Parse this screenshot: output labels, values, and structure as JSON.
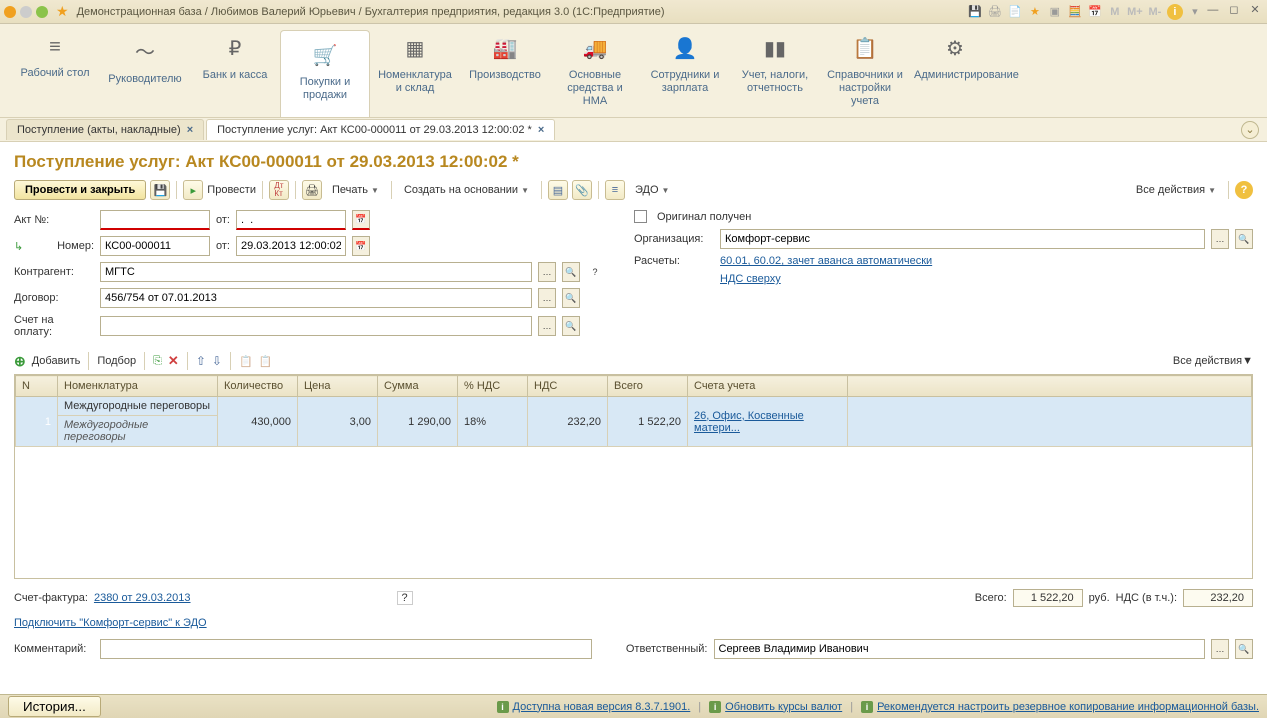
{
  "titlebar": {
    "text": "Демонстрационная база / Любимов Валерий Юрьевич / Бухгалтерия предприятия, редакция 3.0  (1С:Предприятие)"
  },
  "mainnav": [
    {
      "icon": "≡",
      "label": "Рабочий стол"
    },
    {
      "icon": "〜",
      "label": "Руководителю"
    },
    {
      "icon": "₽",
      "label": "Банк и касса"
    },
    {
      "icon": "🛒",
      "label": "Покупки и продажи"
    },
    {
      "icon": "▦",
      "label": "Номенклатура и склад"
    },
    {
      "icon": "🏭",
      "label": "Производство"
    },
    {
      "icon": "🚚",
      "label": "Основные средства и НМА"
    },
    {
      "icon": "👤",
      "label": "Сотрудники и зарплата"
    },
    {
      "icon": "▮▮",
      "label": "Учет, налоги, отчетность"
    },
    {
      "icon": "📋",
      "label": "Справочники и настройки учета"
    },
    {
      "icon": "⚙",
      "label": "Администрирование"
    }
  ],
  "tabs": [
    {
      "label": "Поступление (акты, накладные)",
      "active": false
    },
    {
      "label": "Поступление услуг: Акт КС00-000011 от 29.03.2013 12:00:02 *",
      "active": true
    }
  ],
  "page_title": "Поступление услуг: Акт КС00-000011 от 29.03.2013 12:00:02 *",
  "toolbar": {
    "post_close": "Провести и закрыть",
    "post": "Провести",
    "print": "Печать",
    "create_based": "Создать на основании",
    "edo": "ЭДО",
    "all_actions": "Все действия"
  },
  "form": {
    "act_no_label": "Акт №:",
    "act_no_value": "",
    "from_label": "от:",
    "act_date_value": ".  .",
    "number_label": "Номер:",
    "number_value": "КС00-000011",
    "date_value": "29.03.2013 12:00:02",
    "original_label": "Оригинал получен",
    "org_label": "Организация:",
    "org_value": "Комфорт-сервис",
    "contr_label": "Контрагент:",
    "contr_value": "МГТС",
    "calc_label": "Расчеты:",
    "calc_link": "60.01, 60.02, зачет аванса автоматически",
    "contract_label": "Договор:",
    "contract_value": "456/754 от 07.01.2013",
    "nds_link": "НДС сверху",
    "invoice_label": "Счет на оплату:",
    "invoice_value": ""
  },
  "tbl_toolbar": {
    "add": "Добавить",
    "select": "Подбор",
    "all_actions": "Все действия"
  },
  "grid": {
    "headers": [
      "N",
      "Номенклатура",
      "Количество",
      "Цена",
      "Сумма",
      "% НДС",
      "НДС",
      "Всего",
      "Счета учета",
      ""
    ],
    "rows": [
      {
        "n": "1",
        "nom": "Междугородные переговоры",
        "nom2": "Междугородные переговоры",
        "qty": "430,000",
        "price": "3,00",
        "sum": "1 290,00",
        "vat_pct": "18%",
        "vat": "232,20",
        "total": "1 522,20",
        "acct": "26, Офис, Косвенные матери..."
      }
    ]
  },
  "footer": {
    "sf_label": "Счет-фактура:",
    "sf_link": "2380 от 29.03.2013",
    "edo_link": "Подключить \"Комфорт-сервис\" к ЭДО",
    "comment_label": "Комментарий:",
    "comment_value": "",
    "resp_label": "Ответственный:",
    "resp_value": "Сергеев Владимир Иванович",
    "totals": {
      "total_label": "Всего:",
      "total_value": "1 522,20",
      "currency": "руб.",
      "vat_label": "НДС (в т.ч.):",
      "vat_value": "232,20"
    }
  },
  "statusbar": {
    "history": "История...",
    "s1": "Доступна новая версия 8.3.7.1901.",
    "s2": "Обновить курсы валют",
    "s3": "Рекомендуется настроить резервное копирование информационной базы."
  }
}
